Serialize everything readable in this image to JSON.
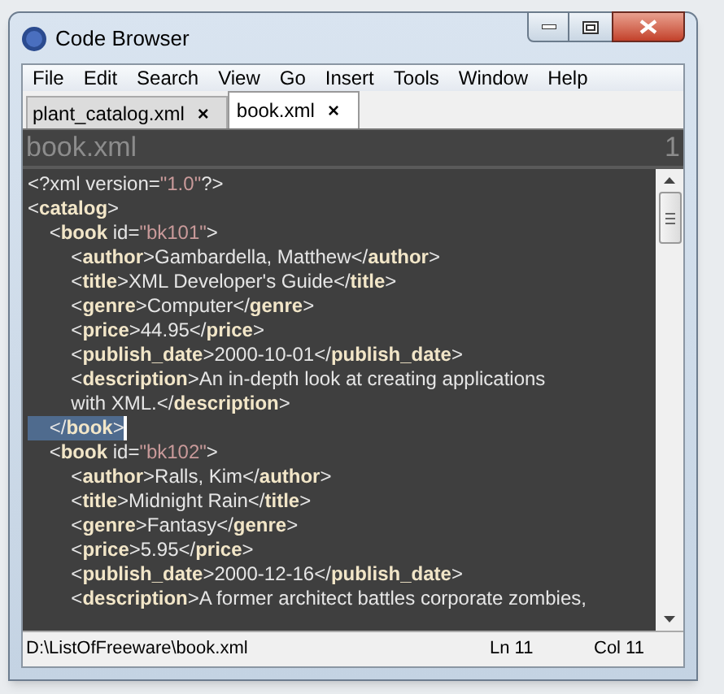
{
  "window": {
    "title": "Code Browser"
  },
  "menu": [
    "File",
    "Edit",
    "Search",
    "View",
    "Go",
    "Insert",
    "Tools",
    "Window",
    "Help"
  ],
  "tabs": [
    {
      "label": "plant_catalog.xml",
      "close": "×",
      "selected": false
    },
    {
      "label": "book.xml",
      "close": "×",
      "selected": true
    }
  ],
  "header": {
    "file": "book.xml",
    "number": "1"
  },
  "lines": [
    {
      "selected": false,
      "segments": [
        {
          "kind": "plain",
          "text": "<?xml version="
        },
        {
          "kind": "string",
          "text": "\"1.0\""
        },
        {
          "kind": "plain",
          "text": "?>"
        }
      ]
    },
    {
      "selected": false,
      "segments": [
        {
          "kind": "plain",
          "text": "<"
        },
        {
          "kind": "tag",
          "text": "catalog"
        },
        {
          "kind": "plain",
          "text": ">"
        }
      ]
    },
    {
      "selected": false,
      "segments": [
        {
          "kind": "plain",
          "text": "    <"
        },
        {
          "kind": "tag",
          "text": "book"
        },
        {
          "kind": "plain",
          "text": " id="
        },
        {
          "kind": "string",
          "text": "\"bk101\""
        },
        {
          "kind": "plain",
          "text": ">"
        }
      ]
    },
    {
      "selected": false,
      "segments": [
        {
          "kind": "plain",
          "text": "        <"
        },
        {
          "kind": "tag",
          "text": "author"
        },
        {
          "kind": "plain",
          "text": ">Gambardella, Matthew</"
        },
        {
          "kind": "tag",
          "text": "author"
        },
        {
          "kind": "plain",
          "text": ">"
        }
      ]
    },
    {
      "selected": false,
      "segments": [
        {
          "kind": "plain",
          "text": "        <"
        },
        {
          "kind": "tag",
          "text": "title"
        },
        {
          "kind": "plain",
          "text": ">XML Developer's Guide</"
        },
        {
          "kind": "tag",
          "text": "title"
        },
        {
          "kind": "plain",
          "text": ">"
        }
      ]
    },
    {
      "selected": false,
      "segments": [
        {
          "kind": "plain",
          "text": "        <"
        },
        {
          "kind": "tag",
          "text": "genre"
        },
        {
          "kind": "plain",
          "text": ">Computer</"
        },
        {
          "kind": "tag",
          "text": "genre"
        },
        {
          "kind": "plain",
          "text": ">"
        }
      ]
    },
    {
      "selected": false,
      "segments": [
        {
          "kind": "plain",
          "text": "        <"
        },
        {
          "kind": "tag",
          "text": "price"
        },
        {
          "kind": "plain",
          "text": ">44.95</"
        },
        {
          "kind": "tag",
          "text": "price"
        },
        {
          "kind": "plain",
          "text": ">"
        }
      ]
    },
    {
      "selected": false,
      "segments": [
        {
          "kind": "plain",
          "text": "        <"
        },
        {
          "kind": "tag",
          "text": "publish_date"
        },
        {
          "kind": "plain",
          "text": ">2000-10-01</"
        },
        {
          "kind": "tag",
          "text": "publish_date"
        },
        {
          "kind": "plain",
          "text": ">"
        }
      ]
    },
    {
      "selected": false,
      "segments": [
        {
          "kind": "plain",
          "text": "        <"
        },
        {
          "kind": "tag",
          "text": "description"
        },
        {
          "kind": "plain",
          "text": ">An in-depth look at creating applications"
        }
      ]
    },
    {
      "selected": false,
      "segments": [
        {
          "kind": "plain",
          "text": "        with XML.</"
        },
        {
          "kind": "tag",
          "text": "description"
        },
        {
          "kind": "plain",
          "text": ">"
        }
      ]
    },
    {
      "selected": true,
      "segments": [
        {
          "kind": "plain",
          "text": "    </"
        },
        {
          "kind": "tag",
          "text": "book"
        },
        {
          "kind": "plain",
          "text": ">"
        }
      ]
    },
    {
      "selected": false,
      "segments": [
        {
          "kind": "plain",
          "text": "    <"
        },
        {
          "kind": "tag",
          "text": "book"
        },
        {
          "kind": "plain",
          "text": " id="
        },
        {
          "kind": "string",
          "text": "\"bk102\""
        },
        {
          "kind": "plain",
          "text": ">"
        }
      ]
    },
    {
      "selected": false,
      "segments": [
        {
          "kind": "plain",
          "text": "        <"
        },
        {
          "kind": "tag",
          "text": "author"
        },
        {
          "kind": "plain",
          "text": ">Ralls, Kim</"
        },
        {
          "kind": "tag",
          "text": "author"
        },
        {
          "kind": "plain",
          "text": ">"
        }
      ]
    },
    {
      "selected": false,
      "segments": [
        {
          "kind": "plain",
          "text": "        <"
        },
        {
          "kind": "tag",
          "text": "title"
        },
        {
          "kind": "plain",
          "text": ">Midnight Rain</"
        },
        {
          "kind": "tag",
          "text": "title"
        },
        {
          "kind": "plain",
          "text": ">"
        }
      ]
    },
    {
      "selected": false,
      "segments": [
        {
          "kind": "plain",
          "text": "        <"
        },
        {
          "kind": "tag",
          "text": "genre"
        },
        {
          "kind": "plain",
          "text": ">Fantasy</"
        },
        {
          "kind": "tag",
          "text": "genre"
        },
        {
          "kind": "plain",
          "text": ">"
        }
      ]
    },
    {
      "selected": false,
      "segments": [
        {
          "kind": "plain",
          "text": "        <"
        },
        {
          "kind": "tag",
          "text": "price"
        },
        {
          "kind": "plain",
          "text": ">5.95</"
        },
        {
          "kind": "tag",
          "text": "price"
        },
        {
          "kind": "plain",
          "text": ">"
        }
      ]
    },
    {
      "selected": false,
      "segments": [
        {
          "kind": "plain",
          "text": "        <"
        },
        {
          "kind": "tag",
          "text": "publish_date"
        },
        {
          "kind": "plain",
          "text": ">2000-12-16</"
        },
        {
          "kind": "tag",
          "text": "publish_date"
        },
        {
          "kind": "plain",
          "text": ">"
        }
      ]
    },
    {
      "selected": false,
      "segments": [
        {
          "kind": "plain",
          "text": "        <"
        },
        {
          "kind": "tag",
          "text": "description"
        },
        {
          "kind": "plain",
          "text": ">A former architect battles corporate zombies,"
        }
      ]
    }
  ],
  "status_bar": {
    "path": "D:\\ListOfFreeware\\book.xml",
    "line": "Ln 11",
    "column": "Col 11"
  }
}
